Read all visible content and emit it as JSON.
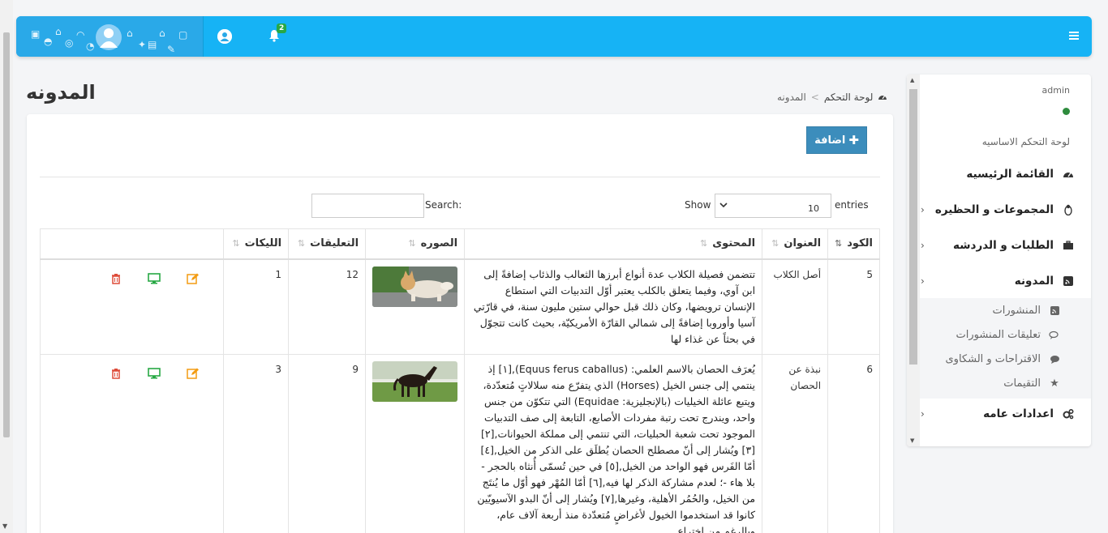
{
  "navbar": {
    "notification_count": "2",
    "icons": [
      "brand-pattern-icon",
      "user-icon",
      "bell-icon",
      "hamburger-icon"
    ]
  },
  "page": {
    "title": "المدونه"
  },
  "breadcrumb": {
    "home": "لوحة التحكم",
    "separator": ">",
    "current": "المدونه"
  },
  "toolbar": {
    "add_label": "اضافة"
  },
  "table_controls": {
    "search_label": "Search:",
    "search_value": "",
    "show_label": "Show",
    "page_length": "10",
    "entries_label": "entries"
  },
  "table": {
    "columns": [
      "الكود",
      "العنوان",
      "المحتوى",
      "الصوره",
      "التعليقات",
      "الليكات",
      ""
    ],
    "rows": [
      {
        "code": "5",
        "title": "أصل الكلاب",
        "content": "تتضمن فصيلة الكلاب عدة أنواع أبرزها الثعالب والذئاب إضافةً إلى ابن آوي، وفيما يتعلق بالكلب يعتبر أوّل التدبيات التي استطاع الإنسان ترويضها، وكان ذلك قبل حوالي ستين مليون سنة، في قارّتي آسيا وأوروبا إضافةً إلى شمالي القارّة الأمريكيّة، بحيث كانت تتجوّل في بحثاً عن غذاء لها",
        "image": "dog-photo",
        "comments": "12",
        "likes": "1"
      },
      {
        "code": "6",
        "title": "نبذة عن الحصان",
        "content": "يُعرَف الحصان بالاسم العلمي: (Equus ferus caballus),[١] إذ ينتمي إلى جنس الخيل (Horses) الذي يتفرّع منه سلالاتٍ مُتعدّدة، ويتبع عائلة الخيليات (بالإنجليزية: Equidae) التي تتكوّن من جنس واحد، ويندرج تحت رتبة مفردات الأصابع، التابعة إلى صف التدبيات الموجود تحت شعبة الحبليات، التي تنتمي إلى مملكة الحيوانات,[٢][٣] ويُشار إلى أنّ مصطلح الحصان يُطلَق على الذكر من الخيل,[٤] أمّا الفَرس فهو الواحد من الخيل,[٥] في حين تُسمّى أُنثاه بالحجر - بلا هاء -؛ لعدم مشاركة الذكر لها فيه,[٦] أمّا المُهْر فهو أوّل ما يُنتَج من الخيل، والحُمُر الأهلية، وغيرها,[٧] ويُشار إلى أنّ البدو الآسيويّين كانوا قد استخدموا الخيول لأغراضٍ مُتعدّدة منذ أربعة آلاف عام، وبالرغم من اختراع",
        "image": "horse-photo",
        "comments": "9",
        "likes": "3"
      }
    ]
  },
  "sidebar": {
    "username": "admin",
    "status_color": "#2e8b3d",
    "section_header": "لوحة التحكم الاساسيه",
    "items": [
      {
        "label": "القائمة الرئيسيه",
        "icon": "dashboard-icon"
      },
      {
        "label": "المجموعات و الحظيره",
        "icon": "linux-icon"
      },
      {
        "label": "الطلبات و الدردشه",
        "icon": "briefcase-icon"
      },
      {
        "label": "المدونه",
        "icon": "rss-icon"
      },
      {
        "label": "اعدادات عامه",
        "icon": "cogs-icon"
      }
    ],
    "blog_subitems": [
      {
        "label": "المنشورات",
        "icon": "rss-square-icon"
      },
      {
        "label": "تعليقات المنشورات",
        "icon": "comments-icon"
      },
      {
        "label": "الاقتراحات و الشكاوى",
        "icon": "comment-icon"
      },
      {
        "label": "التقيمات",
        "icon": "star-icon"
      }
    ]
  },
  "colors": {
    "navbar": "#16b3f5",
    "primary_button": "#3c8dbc",
    "edit_icon": "#f39c12",
    "view_icon": "#27a844",
    "delete_icon": "#dd4b39"
  }
}
